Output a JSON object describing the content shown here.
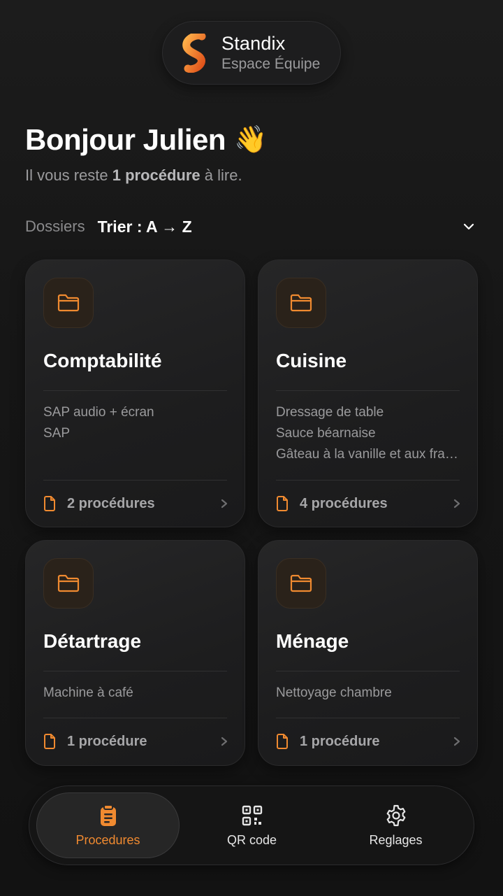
{
  "brand": {
    "name": "Standix",
    "subtitle": "Espace Équipe",
    "accent": "#f08a30"
  },
  "greeting": {
    "title": "Bonjour Julien",
    "emoji": "👋",
    "sub_prefix": "Il vous reste ",
    "sub_bold": "1 procédure",
    "sub_suffix": " à lire."
  },
  "sort": {
    "label": "Dossiers",
    "value": "Trier : A → Z",
    "icon": "chevron-down-icon"
  },
  "folders": [
    {
      "title": "Comptabilité",
      "items": [
        "SAP audio + écran",
        "SAP"
      ],
      "count": "2 procédures"
    },
    {
      "title": "Cuisine",
      "items": [
        "Dressage de table",
        "Sauce béarnaise",
        "Gâteau à la vanille et aux frais..."
      ],
      "count": "4 procédures"
    },
    {
      "title": "Détartrage",
      "items": [
        "Machine à café"
      ],
      "count": "1 procédure"
    },
    {
      "title": "Ménage",
      "items": [
        "Nettoyage chambre"
      ],
      "count": "1 procédure"
    }
  ],
  "nav": [
    {
      "label": "Procedures",
      "icon": "clipboard-icon",
      "active": true
    },
    {
      "label": "QR code",
      "icon": "qr-code-icon",
      "active": false
    },
    {
      "label": "Reglages",
      "icon": "gear-icon",
      "active": false
    }
  ]
}
